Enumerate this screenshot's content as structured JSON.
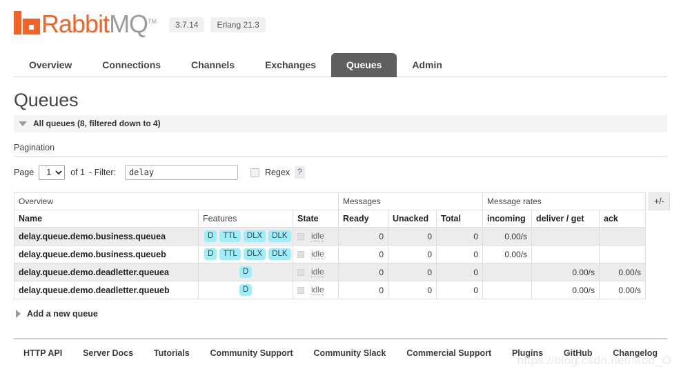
{
  "header": {
    "logo_rabbit": "Rabbit",
    "logo_mq": "MQ",
    "logo_tm": "TM",
    "version": "3.7.14",
    "erlang_version": "Erlang 21.3"
  },
  "nav": {
    "tabs": [
      {
        "label": "Overview",
        "active": false
      },
      {
        "label": "Connections",
        "active": false
      },
      {
        "label": "Channels",
        "active": false
      },
      {
        "label": "Exchanges",
        "active": false
      },
      {
        "label": "Queues",
        "active": true
      },
      {
        "label": "Admin",
        "active": false
      }
    ]
  },
  "main": {
    "page_title": "Queues",
    "all_queues_label": "All queues (8, filtered down to 4)",
    "pagination_label": "Pagination",
    "add_queue_label": "Add a new queue",
    "plus_minus_label": "+/-"
  },
  "filter": {
    "page_label": "Page",
    "page_value": "1",
    "page_options": [
      "1"
    ],
    "of_label": "of 1",
    "filter_label": "- Filter:",
    "filter_value": "delay",
    "filter_placeholder": "",
    "regex_label": "Regex",
    "regex_checked": false,
    "help_label": "?"
  },
  "table": {
    "groups": [
      {
        "label": "Overview",
        "span": 3
      },
      {
        "label": "Messages",
        "span": 3
      },
      {
        "label": "Message rates",
        "span": 3
      }
    ],
    "columns": [
      {
        "label": "Name",
        "bold": true,
        "align": "left"
      },
      {
        "label": "Features",
        "bold": false,
        "align": "left"
      },
      {
        "label": "State",
        "bold": true,
        "align": "left"
      },
      {
        "label": "Ready",
        "bold": true,
        "align": "left"
      },
      {
        "label": "Unacked",
        "bold": true,
        "align": "left"
      },
      {
        "label": "Total",
        "bold": true,
        "align": "left"
      },
      {
        "label": "incoming",
        "bold": true,
        "align": "left"
      },
      {
        "label": "deliver / get",
        "bold": true,
        "align": "left"
      },
      {
        "label": "ack",
        "bold": true,
        "align": "left"
      }
    ],
    "rows": [
      {
        "name": "delay.queue.demo.business.queuea",
        "features": [
          "D",
          "TTL",
          "DLX",
          "DLK"
        ],
        "state": "idle",
        "ready": "0",
        "unacked": "0",
        "total": "0",
        "incoming": "0.00/s",
        "deliver_get": "",
        "ack": ""
      },
      {
        "name": "delay.queue.demo.business.queueb",
        "features": [
          "D",
          "TTL",
          "DLX",
          "DLK"
        ],
        "state": "idle",
        "ready": "0",
        "unacked": "0",
        "total": "0",
        "incoming": "0.00/s",
        "deliver_get": "",
        "ack": ""
      },
      {
        "name": "delay.queue.demo.deadletter.queuea",
        "features": [
          "D"
        ],
        "state": "idle",
        "ready": "0",
        "unacked": "0",
        "total": "0",
        "incoming": "",
        "deliver_get": "0.00/s",
        "ack": "0.00/s"
      },
      {
        "name": "delay.queue.demo.deadletter.queueb",
        "features": [
          "D"
        ],
        "state": "idle",
        "ready": "0",
        "unacked": "0",
        "total": "0",
        "incoming": "",
        "deliver_get": "0.00/s",
        "ack": "0.00/s"
      }
    ]
  },
  "footer": {
    "links": [
      "HTTP API",
      "Server Docs",
      "Tutorials",
      "Community Support",
      "Community Slack",
      "Commercial Support",
      "Plugins",
      "GitHub",
      "Changelog"
    ],
    "watermark": "https://blog.csdn.net/Mod_O"
  },
  "colors": {
    "brand_orange": "#f36325",
    "active_tab_bg": "#5f5f5f",
    "feature_badge": "#9ceff8",
    "row_alt_bg": "#ececec"
  }
}
